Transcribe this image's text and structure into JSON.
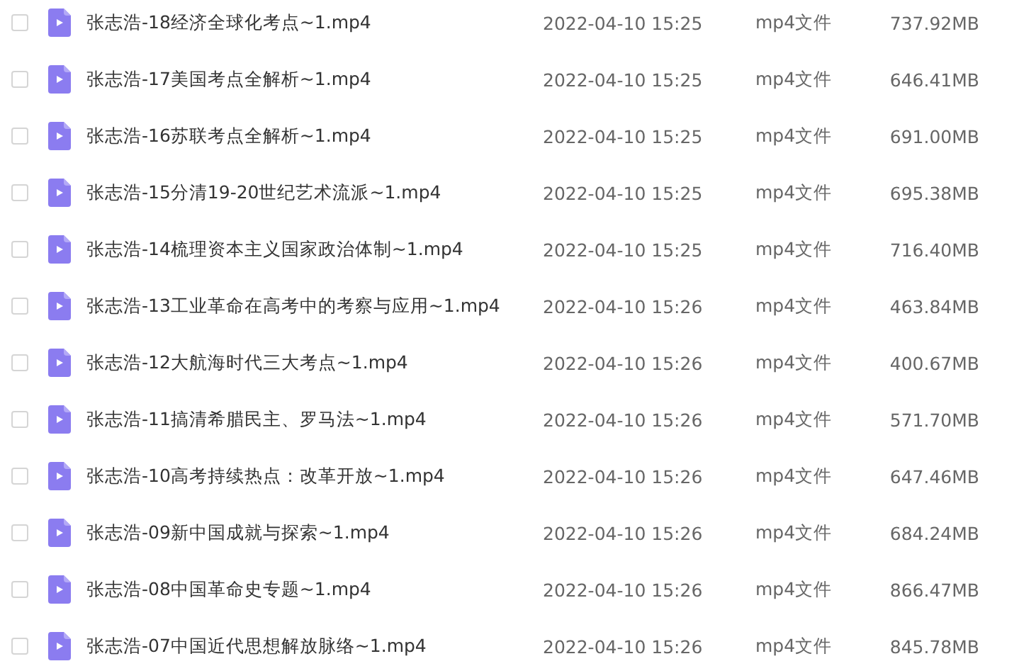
{
  "files": [
    {
      "checked": false,
      "name": "张志浩-18经济全球化考点~1.mp4",
      "modified": "2022-04-10 15:25",
      "type": "mp4文件",
      "size": "737.92MB"
    },
    {
      "checked": false,
      "name": "张志浩-17美国考点全解析~1.mp4",
      "modified": "2022-04-10 15:25",
      "type": "mp4文件",
      "size": "646.41MB"
    },
    {
      "checked": false,
      "name": "张志浩-16苏联考点全解析~1.mp4",
      "modified": "2022-04-10 15:25",
      "type": "mp4文件",
      "size": "691.00MB"
    },
    {
      "checked": false,
      "name": "张志浩-15分清19-20世纪艺术流派~1.mp4",
      "modified": "2022-04-10 15:25",
      "type": "mp4文件",
      "size": "695.38MB"
    },
    {
      "checked": false,
      "name": "张志浩-14梳理资本主义国家政治体制~1.mp4",
      "modified": "2022-04-10 15:25",
      "type": "mp4文件",
      "size": "716.40MB"
    },
    {
      "checked": false,
      "name": "张志浩-13工业革命在高考中的考察与应用~1.mp4",
      "modified": "2022-04-10 15:26",
      "type": "mp4文件",
      "size": "463.84MB"
    },
    {
      "checked": false,
      "name": "张志浩-12大航海时代三大考点~1.mp4",
      "modified": "2022-04-10 15:26",
      "type": "mp4文件",
      "size": "400.67MB"
    },
    {
      "checked": false,
      "name": "张志浩-11搞清希腊民主、罗马法~1.mp4",
      "modified": "2022-04-10 15:26",
      "type": "mp4文件",
      "size": "571.70MB"
    },
    {
      "checked": false,
      "name": "张志浩-10高考持续热点：改革开放~1.mp4",
      "modified": "2022-04-10 15:26",
      "type": "mp4文件",
      "size": "647.46MB"
    },
    {
      "checked": false,
      "name": "张志浩-09新中国成就与探索~1.mp4",
      "modified": "2022-04-10 15:26",
      "type": "mp4文件",
      "size": "684.24MB"
    },
    {
      "checked": false,
      "name": "张志浩-08中国革命史专题~1.mp4",
      "modified": "2022-04-10 15:26",
      "type": "mp4文件",
      "size": "866.47MB"
    },
    {
      "checked": false,
      "name": "张志浩-07中国近代思想解放脉络~1.mp4",
      "modified": "2022-04-10 15:26",
      "type": "mp4文件",
      "size": "845.78MB"
    }
  ]
}
